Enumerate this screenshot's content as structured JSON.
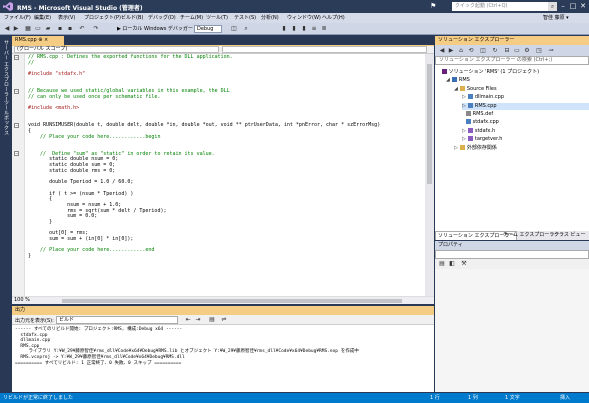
{
  "window": {
    "title": "RMS - Microsoft Visual Studio (管理者)",
    "quick_launch_placeholder": "クイック起動 (Ctrl+Q)",
    "user": "智佳 藤原 ▾"
  },
  "menu": [
    "ファイル(F)",
    "編集(E)",
    "表示(V)",
    "プロジェクト(P)",
    "ビルド(B)",
    "デバッグ(D)",
    "チーム(M)",
    "ツール(T)",
    "テスト(S)",
    "分析(N)",
    "ウィンドウ(W)",
    "ヘルプ(H)"
  ],
  "toolbar": {
    "start_label": "▶ ローカル Windows デバッガー ▾",
    "configuration": "Debug"
  },
  "left_strip": {
    "server_explorer": "サーバー エクスプローラー",
    "toolbox": "ツールボックス"
  },
  "editor": {
    "tab_label": "RMS.cpp  ⊕ ×",
    "scope": "(グローバル スコープ)",
    "zoom": "100 %",
    "lines": [
      {
        "cls": "c",
        "text": "// RMS.cpp : Defines the exported functions for the DLL application."
      },
      {
        "cls": "c",
        "text": "//"
      },
      {
        "cls": "",
        "text": ""
      },
      {
        "cls": "s",
        "text": "#include \"stdafx.h\""
      },
      {
        "cls": "",
        "text": ""
      },
      {
        "cls": "",
        "text": ""
      },
      {
        "cls": "c",
        "text": "// Because we used static/global variables in this example, the DLL"
      },
      {
        "cls": "c",
        "text": "// can only be used once per schematic file."
      },
      {
        "cls": "",
        "text": ""
      },
      {
        "cls": "s",
        "text": "#include <math.h>"
      },
      {
        "cls": "",
        "text": ""
      },
      {
        "cls": "",
        "text": ""
      },
      {
        "cls": "",
        "text": "void RUNSIMUSER(double t, double delt, double *in, double *out, void ** ptrUserData, int *pnError, char * szErrorMsg)"
      },
      {
        "cls": "",
        "text": "{"
      },
      {
        "cls": "c",
        "text": "    // Place your code here............begin"
      },
      {
        "cls": "",
        "text": ""
      },
      {
        "cls": "",
        "text": ""
      },
      {
        "cls": "c",
        "text": "    //  Define \"sum\" as \"static\" in order to retain its value."
      },
      {
        "cls": "",
        "text": "       static double nsum = 0;"
      },
      {
        "cls": "",
        "text": "       static double sum = 0;"
      },
      {
        "cls": "",
        "text": "       static double rms = 0;"
      },
      {
        "cls": "",
        "text": ""
      },
      {
        "cls": "",
        "text": "       double Tperiod = 1.0 / 60.0;"
      },
      {
        "cls": "",
        "text": ""
      },
      {
        "cls": "",
        "text": "       if ( t >= (nsum * Tperiod) )"
      },
      {
        "cls": "",
        "text": "       {"
      },
      {
        "cls": "",
        "text": "             nsum = nsum + 1.0;"
      },
      {
        "cls": "",
        "text": "             rms = sqrt(sum * delt / Tperiod);"
      },
      {
        "cls": "",
        "text": "             sum = 0.0;"
      },
      {
        "cls": "",
        "text": "       }"
      },
      {
        "cls": "",
        "text": ""
      },
      {
        "cls": "",
        "text": "       out[0] = rms;"
      },
      {
        "cls": "",
        "text": "       sum = sum + (in[0] * in[0]);"
      },
      {
        "cls": "",
        "text": ""
      },
      {
        "cls": "c",
        "text": "    // Place your code here............end"
      },
      {
        "cls": "",
        "text": "}"
      }
    ]
  },
  "output": {
    "title": "出力",
    "show_label": "出力元を表示(S):",
    "source": "ビルド",
    "lines": [
      "------ すべてのリビルド開始: プロジェクト:RMS, 構成:Debug x64 ------",
      "  stdafx.cpp",
      "  dllmain.cpp",
      "  RMS.cpp",
      "     ライブラリ Y:¥W_29¥藤原智佳¥rms_dll¥Code¥x64¥Debug¥RMS.lib とオブジェクト Y:¥W_29¥藤原智佳¥rms_dll¥Code¥x64¥Debug¥RMS.exp を作成中",
      "  RMS.vcxproj -> Y:¥W_29¥藤原智佳¥rms_dll¥Code¥x64¥Debug¥RMS.dll",
      "========== すべてリビルド: 1 正常終了、0 失敗、0 スキップ =========="
    ]
  },
  "solution_explorer": {
    "title": "ソリューション エクスプローラー",
    "search_placeholder": "ソリューション エクスプローラー の検索 (Ctrl+;)",
    "tree": [
      {
        "label": "ソリューション 'RMS' (1 プロジェクト)",
        "indent": 0,
        "tri": "",
        "color": "#68217a"
      },
      {
        "label": "RMS",
        "indent": 1,
        "tri": "◢",
        "color": "#3a6fb5"
      },
      {
        "label": "Source Files",
        "indent": 2,
        "tri": "◢",
        "color": "#dcb04c"
      },
      {
        "label": "dllmain.cpp",
        "indent": 3,
        "tri": "▷",
        "color": "#4a7fc0"
      },
      {
        "label": "RMS.cpp",
        "indent": 3,
        "tri": "▷",
        "color": "#4a7fc0",
        "selected": true
      },
      {
        "label": "RMS.def",
        "indent": 3,
        "tri": "",
        "color": "#888888"
      },
      {
        "label": "stdafx.cpp",
        "indent": 3,
        "tri": "",
        "color": "#4a7fc0"
      },
      {
        "label": "stdafx.h",
        "indent": 3,
        "tri": "▷",
        "color": "#8a5cc0"
      },
      {
        "label": "targetver.h",
        "indent": 3,
        "tri": "▷",
        "color": "#8a5cc0"
      },
      {
        "label": "外部依存関係",
        "indent": 2,
        "tri": "▷",
        "color": "#dcb04c"
      }
    ],
    "tabs": [
      "ソリューション エクスプローラー",
      "チーム エクスプローラー",
      "クラス ビュー"
    ]
  },
  "properties": {
    "title": "プロパティ"
  },
  "statusbar": {
    "message": "リビルドが正常に終了しました",
    "line": "1 行",
    "col": "1 列",
    "ch": "1 文字",
    "mode": "挿入"
  },
  "colors": {
    "chrome": "#293955",
    "accent_tab": "#f5cc84",
    "status": "#007acc"
  }
}
